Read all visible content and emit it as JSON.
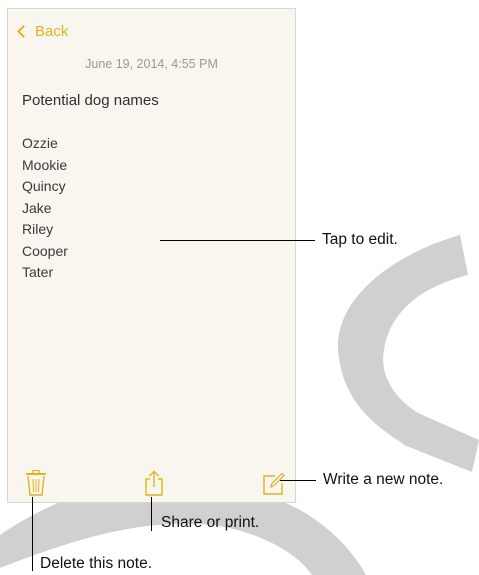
{
  "nav": {
    "back_label": "Back"
  },
  "note": {
    "date": "June 19, 2014, 4:55 PM",
    "title": "Potential dog names",
    "names": [
      "Ozzie",
      "Mookie",
      "Quincy",
      "Jake",
      "Riley",
      "Cooper",
      "Tater"
    ]
  },
  "toolbar": {
    "delete_icon": "trash-icon",
    "share_icon": "share-icon",
    "compose_icon": "compose-icon"
  },
  "callouts": {
    "edit": "Tap to edit.",
    "new_note": "Write a new note.",
    "share": "Share or print.",
    "delete": "Delete this note."
  },
  "colors": {
    "accent": "#e3b21f",
    "paper": "#f8f6ef",
    "arc": "#d0d0d0"
  }
}
